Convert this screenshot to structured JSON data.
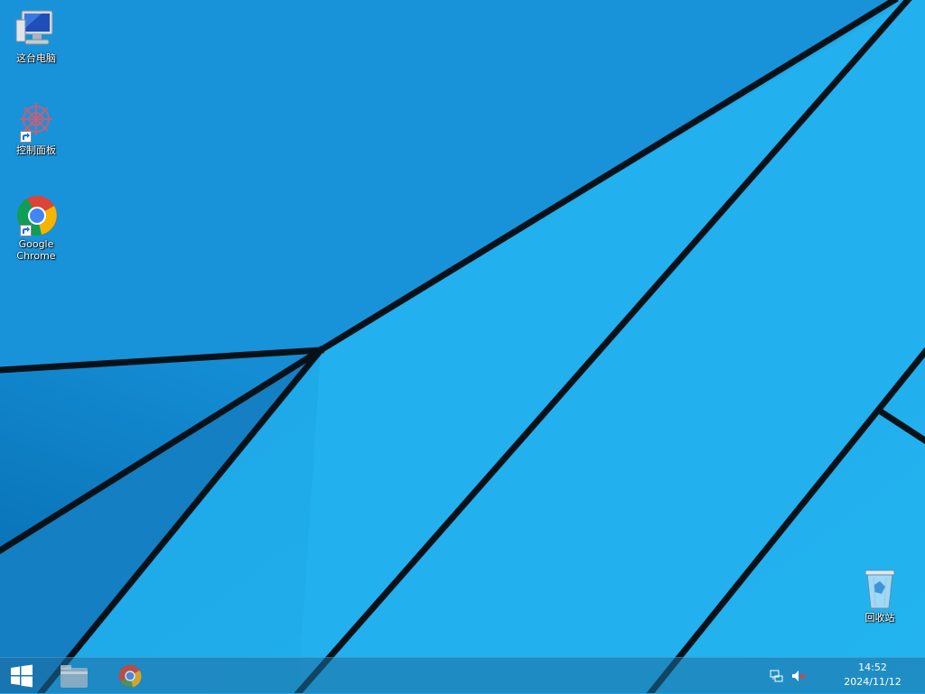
{
  "desktop": {
    "icons": [
      {
        "name": "computer",
        "label": "这台电脑"
      },
      {
        "name": "settings",
        "label": "控制面板"
      },
      {
        "name": "chrome",
        "label": "Google Chrome"
      },
      {
        "name": "recycle-bin",
        "label": "回收站"
      }
    ]
  },
  "taskbar": {
    "start_icon": "windows-logo-icon",
    "pinned": [
      {
        "name": "file-explorer",
        "icon": "folder-icon"
      },
      {
        "name": "chrome",
        "icon": "chrome-icon"
      }
    ],
    "tray": {
      "network_icon": "network-icon",
      "volume_icon": "volume-muted-icon",
      "time": "14:52",
      "date": "2024/11/12"
    }
  },
  "colors": {
    "wallpaper_blue": "#1aa3e6",
    "taskbar": "#1e6ea0"
  }
}
